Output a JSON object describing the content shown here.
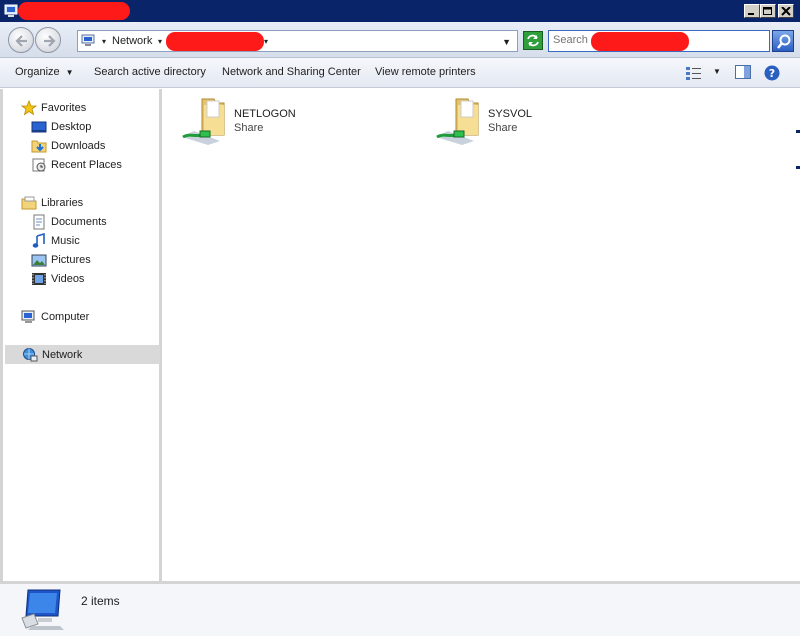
{
  "window": {
    "title": ""
  },
  "navbar": {
    "back_label": "Back",
    "forward_label": "Forward",
    "breadcrumbs": [
      "Network",
      ""
    ],
    "search_placeholder": "Search"
  },
  "commandbar": {
    "organize": "Organize",
    "search_ad": "Search active directory",
    "network_sharing": "Network and Sharing Center",
    "view_printers": "View remote printers"
  },
  "sidebar": {
    "favorites": {
      "label": "Favorites",
      "items": [
        {
          "label": "Desktop",
          "icon": "desktop-icon"
        },
        {
          "label": "Downloads",
          "icon": "downloads-icon"
        },
        {
          "label": "Recent Places",
          "icon": "recent-places-icon"
        }
      ]
    },
    "libraries": {
      "label": "Libraries",
      "items": [
        {
          "label": "Documents",
          "icon": "documents-icon"
        },
        {
          "label": "Music",
          "icon": "music-icon"
        },
        {
          "label": "Pictures",
          "icon": "pictures-icon"
        },
        {
          "label": "Videos",
          "icon": "videos-icon"
        }
      ]
    },
    "computer": "Computer",
    "network": "Network",
    "selected": "Network"
  },
  "content": {
    "shares": [
      {
        "name": "NETLOGON",
        "type": "Share"
      },
      {
        "name": "SYSVOL",
        "type": "Share"
      }
    ]
  },
  "status": {
    "item_count": "2 items"
  },
  "colors": {
    "titlebar": "#0a246a",
    "redaction": "#ff1a1a",
    "selection": "#d9d9d9"
  }
}
